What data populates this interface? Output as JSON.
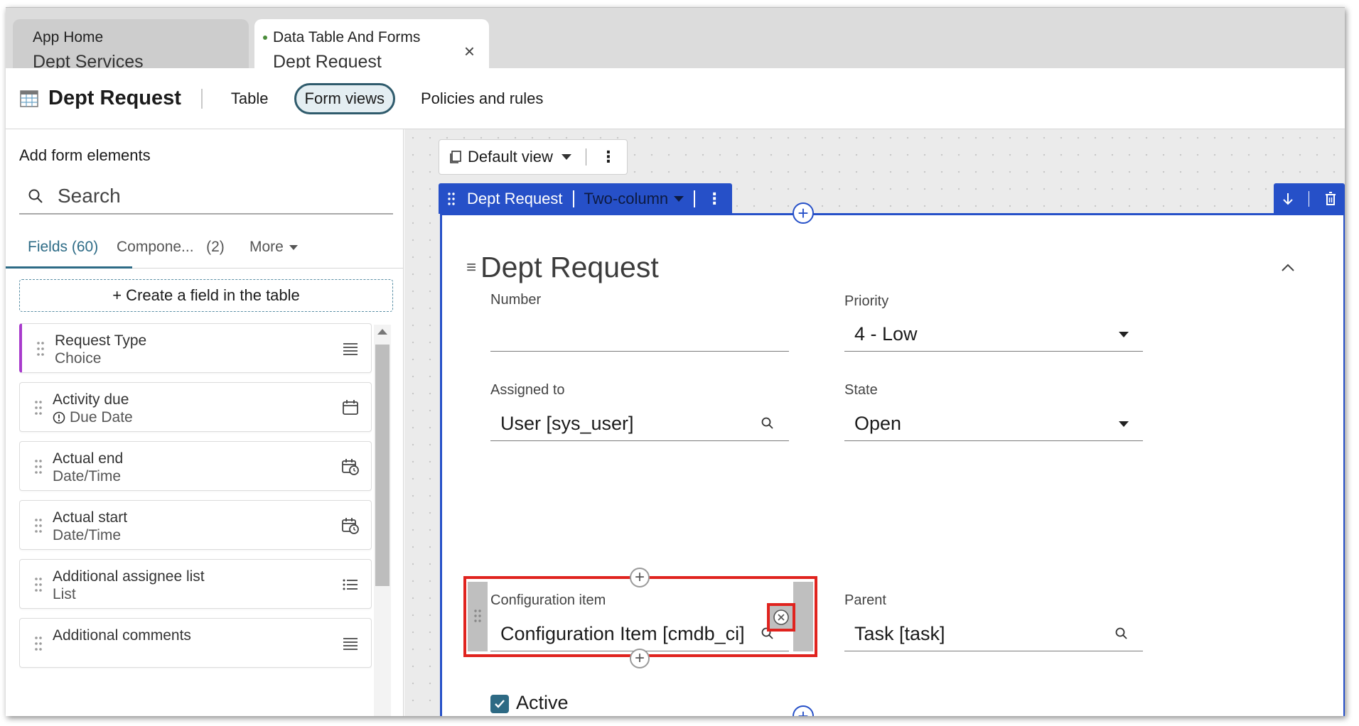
{
  "tabs": [
    {
      "line1": "App Home",
      "line2": "Dept Services"
    },
    {
      "line1": "Data Table And Forms",
      "line2": "Dept Request",
      "close": "×"
    }
  ],
  "header": {
    "title": "Dept Request",
    "nav": [
      "Table",
      "Form views",
      "Policies and rules"
    ],
    "active_nav": "Form views"
  },
  "left_panel": {
    "heading": "Add form elements",
    "search_placeholder": "Search",
    "tabs": {
      "fields": "Fields (60)",
      "components": "Compone...",
      "components_count": "(2)",
      "more": "More"
    },
    "create_button": "+ Create a field in the table",
    "fields": [
      {
        "name": "Request Type",
        "type": "Choice",
        "icon": "choice-list-icon"
      },
      {
        "name": "Activity due",
        "type": "Due Date",
        "icon": "calendar-icon"
      },
      {
        "name": "Actual end",
        "type": "Date/Time",
        "icon": "calendar-clock-icon"
      },
      {
        "name": "Actual start",
        "type": "Date/Time",
        "icon": "calendar-clock-icon"
      },
      {
        "name": "Additional assignee list",
        "type": "List",
        "icon": "list-icon"
      },
      {
        "name": "Additional comments",
        "type": "",
        "icon": "choice-list-icon"
      }
    ]
  },
  "canvas": {
    "view_selector": "Default view",
    "form_bar": {
      "name": "Dept Request",
      "layout": "Two-column"
    },
    "section_title": "Dept Request",
    "fields": {
      "number": {
        "label": "Number",
        "value": ""
      },
      "priority": {
        "label": "Priority",
        "value": "4 - Low"
      },
      "assigned_to": {
        "label": "Assigned to",
        "value": "User [sys_user]"
      },
      "state": {
        "label": "State",
        "value": "Open"
      },
      "configuration_item": {
        "label": "Configuration item",
        "value": "Configuration Item [cmdb_ci]"
      },
      "parent": {
        "label": "Parent",
        "value": "Task [task]"
      }
    },
    "active": {
      "label": "Active",
      "checked": true
    }
  },
  "colors": {
    "accent_blue": "#2650c8",
    "highlight_red": "#e0231e",
    "teal": "#2d6b86",
    "purple": "#a83acc"
  }
}
